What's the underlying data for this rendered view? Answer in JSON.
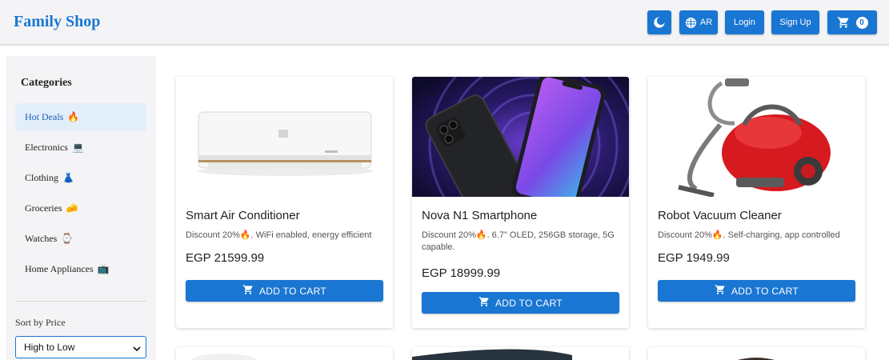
{
  "header": {
    "brand": "Family Shop",
    "theme_icon": "moon-icon",
    "lang_icon": "globe-icon",
    "lang_label": "AR",
    "login_label": "Login",
    "signup_label": "Sign Up",
    "cart_icon": "cart-icon",
    "cart_count": "0",
    "accent": "#1976d2"
  },
  "sidebar": {
    "title": "Categories",
    "items": [
      {
        "label": "Hot Deals",
        "emoji": "🔥",
        "active": true
      },
      {
        "label": "Electronics",
        "emoji": "💻",
        "active": false
      },
      {
        "label": "Clothing",
        "emoji": "👗",
        "active": false
      },
      {
        "label": "Groceries",
        "emoji": "🧀",
        "active": false
      },
      {
        "label": "Watches",
        "emoji": "⌚",
        "active": false
      },
      {
        "label": "Home Appliances",
        "emoji": "📺",
        "active": false
      }
    ],
    "sort_label": "Sort by Price",
    "sort_value": "High to Low"
  },
  "products": [
    {
      "name": "Smart Air Conditioner",
      "desc": "Discount 20%🔥. WiFi enabled, energy efficient",
      "price": "EGP 21599.99",
      "button": "ADD TO CART"
    },
    {
      "name": "Nova N1 Smartphone",
      "desc": "Discount 20%🔥. 6.7\" OLED, 256GB storage, 5G capable.",
      "price": "EGP 18999.99",
      "button": "ADD TO CART"
    },
    {
      "name": "Robot Vacuum Cleaner",
      "desc": "Discount 20%🔥. Self-charging, app controlled",
      "price": "EGP 1949.99",
      "button": "ADD TO CART"
    }
  ]
}
